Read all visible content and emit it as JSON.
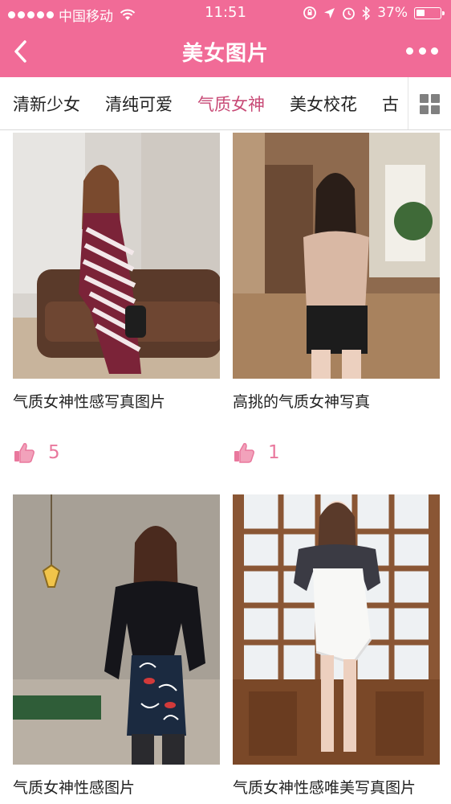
{
  "status_bar": {
    "carrier": "中国移动",
    "time": "11:51",
    "battery_percent": "37%",
    "battery_level": 0.37
  },
  "nav": {
    "title": "美女图片"
  },
  "tabs": [
    {
      "label": "清新少女"
    },
    {
      "label": "清纯可爱"
    },
    {
      "label": "气质女神",
      "active": true
    },
    {
      "label": "美女校花"
    },
    {
      "label": "古"
    }
  ],
  "colors": {
    "brand": "#f16b97",
    "active_tab": "#c84a76",
    "like": "#e9789d"
  },
  "cards": [
    {
      "caption": "气质女神性感写真图片",
      "likes": "5"
    },
    {
      "caption": "高挑的气质女神写真",
      "likes": "1"
    },
    {
      "caption": "气质女神性感图片"
    },
    {
      "caption": "气质女神性感唯美写真图片"
    }
  ]
}
